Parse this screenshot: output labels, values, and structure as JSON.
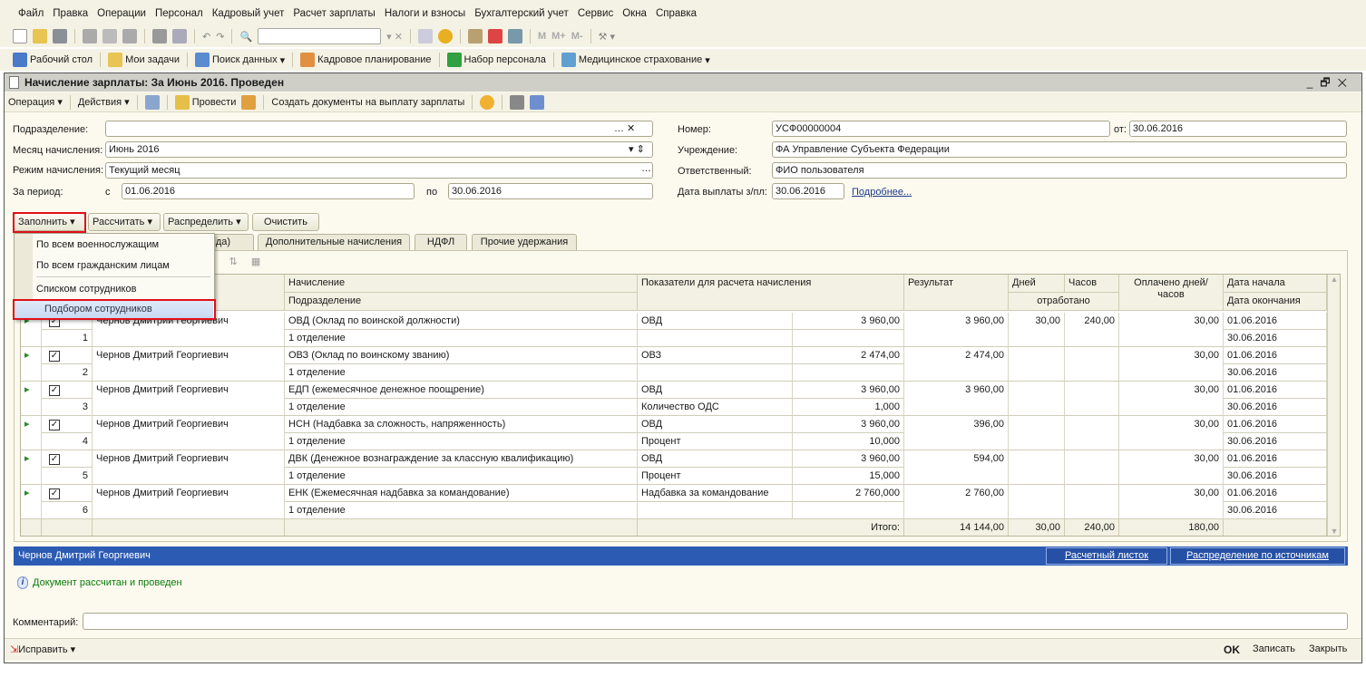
{
  "menu": [
    "Файл",
    "Правка",
    "Операции",
    "Персонал",
    "Кадровый учет",
    "Расчет зарплаты",
    "Налоги и взносы",
    "Бухгалтерский учет",
    "Сервис",
    "Окна",
    "Справка"
  ],
  "toolbar2": [
    "Рабочий стол",
    "Мои задачи",
    "Поиск данных",
    "Кадровое планирование",
    "Набор персонала",
    "Медицинское страхование"
  ],
  "toolbar1": {
    "m": "M",
    "mplus": "M+",
    "mminus": "M-",
    "search_value": ""
  },
  "window": {
    "title": "Начисление зарплаты: За Июнь 2016. Проведен",
    "controls": [
      "_",
      "🗗",
      "✕"
    ]
  },
  "cmd": {
    "operation": "Операция",
    "actions": "Действия",
    "post": "Провести",
    "create": "Создать документы на выплату зарплаты"
  },
  "form": {
    "dept_label": "Подразделение:",
    "dept_value": "",
    "month_label": "Месяц начисления:",
    "month_value": "Июнь 2016",
    "mode_label": "Режим начисления:",
    "mode_value": "Текущий месяц",
    "period_label": "За период:",
    "from_label": "с",
    "from_value": "01.06.2016",
    "to_label": "по",
    "to_value": "30.06.2016",
    "number_label": "Номер:",
    "number_value": "УСФ00000004",
    "date_label": "от:",
    "date_value": "30.06.2016",
    "org_label": "Учреждение:",
    "org_value": "ФА Управление Субъекта Федерации",
    "resp_label": "Ответственный:",
    "resp_value": "ФИО пользователя",
    "paydate_label": "Дата выплаты з/пл:",
    "paydate_value": "30.06.2016",
    "more_link": "Подробнее..."
  },
  "buttons": {
    "fill": "Заполнить",
    "calc": "Рассчитать",
    "distribute": "Распределить",
    "clear": "Очистить"
  },
  "tabs": [
    "ряда)",
    "Дополнительные начисления",
    "НДФЛ",
    "Прочие удержания"
  ],
  "dropdown": {
    "items": [
      "По всем военнослужащим",
      "По всем гражданским лицам",
      "Списком сотрудников",
      "Подбором сотрудников"
    ],
    "highlighted": "Подбором сотрудников"
  },
  "table": {
    "headers": {
      "accrual": "Начисление",
      "dept": "Подразделение",
      "indicators": "Показатели для расчета начисления",
      "result": "Результат",
      "days": "Дней",
      "hours": "Часов",
      "worked": "отработано",
      "paid": "Оплачено дней/часов",
      "start": "Дата начала",
      "end": "Дата окончания"
    },
    "rows": [
      {
        "n": "1",
        "checked": true,
        "name": "Чернов Дмитрий Георгиевич",
        "accrual": "ОВД (Оклад по воинской должности)",
        "dept": "1 отделение",
        "i1": "ОВД",
        "v1": "3 960,00",
        "i2": "",
        "v2": "",
        "result": "3 960,00",
        "days": "30,00",
        "hours": "240,00",
        "paid": "30,00",
        "start": "01.06.2016",
        "end": "30.06.2016"
      },
      {
        "n": "2",
        "checked": true,
        "name": "Чернов Дмитрий Георгиевич",
        "accrual": "ОВЗ (Оклад по воинскому званию)",
        "dept": "1 отделение",
        "i1": "ОВЗ",
        "v1": "2 474,00",
        "i2": "",
        "v2": "",
        "result": "2 474,00",
        "days": "",
        "hours": "",
        "paid": "30,00",
        "start": "01.06.2016",
        "end": "30.06.2016"
      },
      {
        "n": "3",
        "checked": true,
        "name": "Чернов Дмитрий Георгиевич",
        "accrual": "ЕДП (ежемесячное денежное поощрение)",
        "dept": "1 отделение",
        "i1": "ОВД",
        "v1": "3 960,00",
        "i2": "Количество ОДС",
        "v2": "1,000",
        "result": "3 960,00",
        "days": "",
        "hours": "",
        "paid": "30,00",
        "start": "01.06.2016",
        "end": "30.06.2016"
      },
      {
        "n": "4",
        "checked": true,
        "name": "Чернов Дмитрий Георгиевич",
        "accrual": "НСН (Надбавка за сложность, напряженность)",
        "dept": "1 отделение",
        "i1": "ОВД",
        "v1": "3 960,00",
        "i2": "Процент",
        "v2": "10,000",
        "result": "396,00",
        "days": "",
        "hours": "",
        "paid": "30,00",
        "start": "01.06.2016",
        "end": "30.06.2016"
      },
      {
        "n": "5",
        "checked": true,
        "name": "Чернов Дмитрий Георгиевич",
        "accrual": "ДВК (Денежное вознаграждение за классную квалификацию)",
        "dept": "1 отделение",
        "i1": "ОВД",
        "v1": "3 960,00",
        "i2": "Процент",
        "v2": "15,000",
        "result": "594,00",
        "days": "",
        "hours": "",
        "paid": "30,00",
        "start": "01.06.2016",
        "end": "30.06.2016"
      },
      {
        "n": "6",
        "checked": true,
        "name": "Чернов Дмитрий Георгиевич",
        "accrual": "ЕНК (Ежемесячная надбавка за командование)",
        "dept": "1 отделение",
        "i1": "Надбавка за командование",
        "v1": "2 760,000",
        "i2": "",
        "v2": "",
        "result": "2 760,00",
        "days": "",
        "hours": "",
        "paid": "30,00",
        "start": "01.06.2016",
        "end": "30.06.2016"
      }
    ],
    "totals": {
      "label": "Итого:",
      "result": "14 144,00",
      "days": "30,00",
      "hours": "240,00",
      "paid": "180,00"
    }
  },
  "employee_bar": {
    "name": "Чернов Дмитрий Георгиевич",
    "payslip": "Расчетный листок",
    "sources": "Распределение по источникам"
  },
  "info": "Документ рассчитан и проведен",
  "comment": {
    "label": "Комментарий:",
    "value": ""
  },
  "bottom": {
    "fix": "Исправить",
    "ok": "OK",
    "save": "Записать",
    "close": "Закрыть"
  },
  "colors": {
    "accent_blue": "#2c5bb3",
    "highlight_red": "#e0101a",
    "info_green": "#0a7a0a",
    "background": "#fcfaef"
  }
}
